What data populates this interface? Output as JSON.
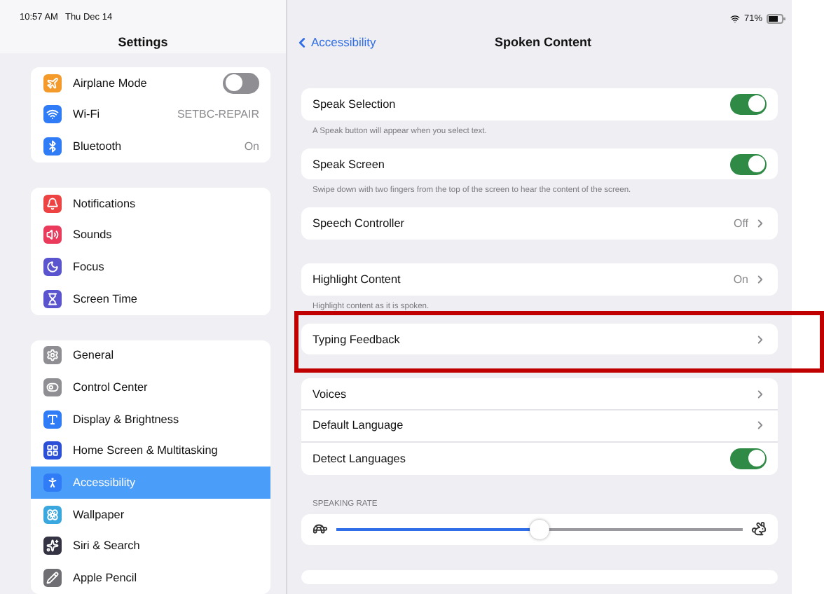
{
  "status_bar": {
    "time": "10:57 AM",
    "date": "Thu Dec 14",
    "battery": "71%"
  },
  "sidebar": {
    "title": "Settings",
    "groups": [
      {
        "items": [
          {
            "label": "Airplane Mode",
            "kind": "toggle",
            "on": false,
            "color": "#f39a2b",
            "selected": false
          },
          {
            "label": "Wi-Fi",
            "kind": "value",
            "value": "SETBC-REPAIR",
            "color": "#2f7cf6",
            "selected": false
          },
          {
            "label": "Bluetooth",
            "kind": "value",
            "value": "On",
            "color": "#2f7cf6",
            "selected": false
          }
        ]
      },
      {
        "items": [
          {
            "label": "Notifications",
            "kind": "plain",
            "color": "#ee4343",
            "selected": false
          },
          {
            "label": "Sounds",
            "kind": "plain",
            "color": "#ea3b5c",
            "selected": false
          },
          {
            "label": "Focus",
            "kind": "plain",
            "color": "#5a55cf",
            "selected": false
          },
          {
            "label": "Screen Time",
            "kind": "plain",
            "color": "#5a55cf",
            "selected": false
          }
        ]
      },
      {
        "items": [
          {
            "label": "General",
            "kind": "plain",
            "color": "#8e8e93",
            "selected": false
          },
          {
            "label": "Control Center",
            "kind": "plain",
            "color": "#8e8e93",
            "selected": false
          },
          {
            "label": "Display & Brightness",
            "kind": "plain",
            "color": "#2f7cf6",
            "selected": false
          },
          {
            "label": "Home Screen & Multitasking",
            "kind": "plain",
            "color": "#2c4fd8",
            "selected": false
          },
          {
            "label": "Accessibility",
            "kind": "plain",
            "color": "#2f7cf6",
            "selected": true
          },
          {
            "label": "Wallpaper",
            "kind": "plain",
            "color": "#3aa8df",
            "selected": false
          },
          {
            "label": "Siri & Search",
            "kind": "plain",
            "color": "#333344",
            "selected": false
          },
          {
            "label": "Apple Pencil",
            "kind": "plain",
            "color": "#6e6e73",
            "selected": false
          }
        ]
      }
    ]
  },
  "detail": {
    "back": "Accessibility",
    "title": "Spoken Content",
    "groups": [
      {
        "highlighted": false,
        "rows": [
          {
            "label": "Speak Selection",
            "kind": "toggle",
            "on": true
          }
        ],
        "footer": "A Speak button will appear when you select text."
      },
      {
        "highlighted": false,
        "rows": [
          {
            "label": "Speak Screen",
            "kind": "toggle",
            "on": true
          }
        ],
        "footer": "Swipe down with two fingers from the top of the screen to hear the content of the screen."
      },
      {
        "highlighted": false,
        "rows": [
          {
            "label": "Speech Controller",
            "kind": "link",
            "value": "Off"
          }
        ]
      },
      {
        "highlighted": false,
        "rows": [
          {
            "label": "Highlight Content",
            "kind": "link",
            "value": "On"
          }
        ],
        "footer": "Highlight content as it is spoken."
      },
      {
        "highlighted": true,
        "rows": [
          {
            "label": "Typing Feedback",
            "kind": "link"
          }
        ]
      },
      {
        "highlighted": false,
        "rows": [
          {
            "label": "Voices",
            "kind": "link"
          },
          {
            "label": "Default Language",
            "kind": "link"
          },
          {
            "label": "Detect Languages",
            "kind": "toggle",
            "on": true
          }
        ]
      }
    ],
    "section_header": "SPEAKING RATE",
    "speaking_rate": {
      "level": 0.5
    }
  }
}
